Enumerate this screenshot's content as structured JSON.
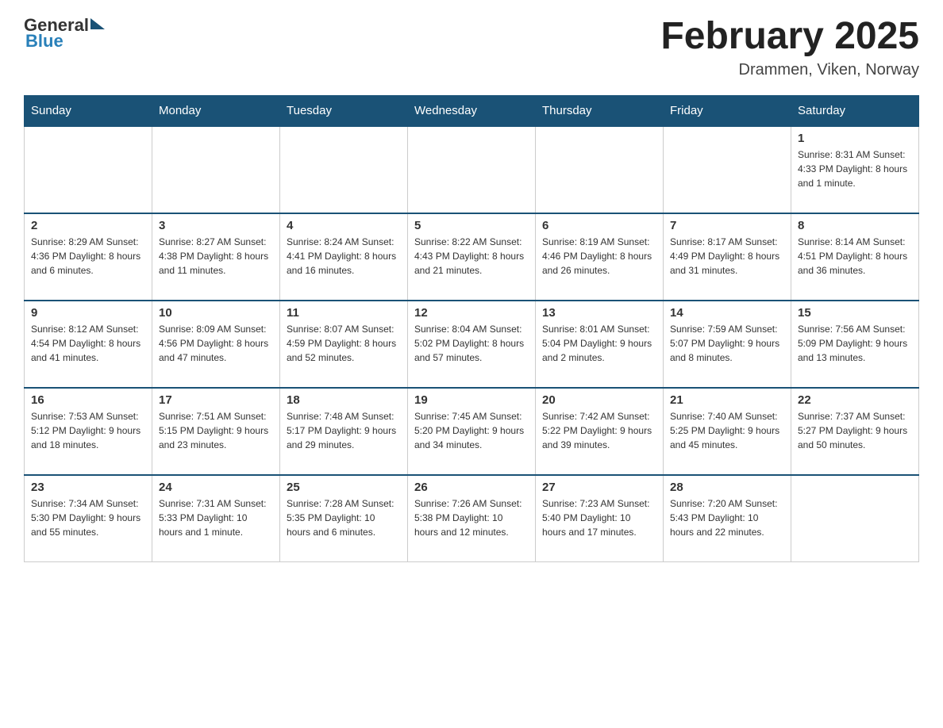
{
  "header": {
    "logo_general": "General",
    "logo_blue": "Blue",
    "month_title": "February 2025",
    "location": "Drammen, Viken, Norway"
  },
  "weekdays": [
    "Sunday",
    "Monday",
    "Tuesday",
    "Wednesday",
    "Thursday",
    "Friday",
    "Saturday"
  ],
  "weeks": [
    [
      {
        "day": "",
        "info": ""
      },
      {
        "day": "",
        "info": ""
      },
      {
        "day": "",
        "info": ""
      },
      {
        "day": "",
        "info": ""
      },
      {
        "day": "",
        "info": ""
      },
      {
        "day": "",
        "info": ""
      },
      {
        "day": "1",
        "info": "Sunrise: 8:31 AM\nSunset: 4:33 PM\nDaylight: 8 hours and 1 minute."
      }
    ],
    [
      {
        "day": "2",
        "info": "Sunrise: 8:29 AM\nSunset: 4:36 PM\nDaylight: 8 hours and 6 minutes."
      },
      {
        "day": "3",
        "info": "Sunrise: 8:27 AM\nSunset: 4:38 PM\nDaylight: 8 hours and 11 minutes."
      },
      {
        "day": "4",
        "info": "Sunrise: 8:24 AM\nSunset: 4:41 PM\nDaylight: 8 hours and 16 minutes."
      },
      {
        "day": "5",
        "info": "Sunrise: 8:22 AM\nSunset: 4:43 PM\nDaylight: 8 hours and 21 minutes."
      },
      {
        "day": "6",
        "info": "Sunrise: 8:19 AM\nSunset: 4:46 PM\nDaylight: 8 hours and 26 minutes."
      },
      {
        "day": "7",
        "info": "Sunrise: 8:17 AM\nSunset: 4:49 PM\nDaylight: 8 hours and 31 minutes."
      },
      {
        "day": "8",
        "info": "Sunrise: 8:14 AM\nSunset: 4:51 PM\nDaylight: 8 hours and 36 minutes."
      }
    ],
    [
      {
        "day": "9",
        "info": "Sunrise: 8:12 AM\nSunset: 4:54 PM\nDaylight: 8 hours and 41 minutes."
      },
      {
        "day": "10",
        "info": "Sunrise: 8:09 AM\nSunset: 4:56 PM\nDaylight: 8 hours and 47 minutes."
      },
      {
        "day": "11",
        "info": "Sunrise: 8:07 AM\nSunset: 4:59 PM\nDaylight: 8 hours and 52 minutes."
      },
      {
        "day": "12",
        "info": "Sunrise: 8:04 AM\nSunset: 5:02 PM\nDaylight: 8 hours and 57 minutes."
      },
      {
        "day": "13",
        "info": "Sunrise: 8:01 AM\nSunset: 5:04 PM\nDaylight: 9 hours and 2 minutes."
      },
      {
        "day": "14",
        "info": "Sunrise: 7:59 AM\nSunset: 5:07 PM\nDaylight: 9 hours and 8 minutes."
      },
      {
        "day": "15",
        "info": "Sunrise: 7:56 AM\nSunset: 5:09 PM\nDaylight: 9 hours and 13 minutes."
      }
    ],
    [
      {
        "day": "16",
        "info": "Sunrise: 7:53 AM\nSunset: 5:12 PM\nDaylight: 9 hours and 18 minutes."
      },
      {
        "day": "17",
        "info": "Sunrise: 7:51 AM\nSunset: 5:15 PM\nDaylight: 9 hours and 23 minutes."
      },
      {
        "day": "18",
        "info": "Sunrise: 7:48 AM\nSunset: 5:17 PM\nDaylight: 9 hours and 29 minutes."
      },
      {
        "day": "19",
        "info": "Sunrise: 7:45 AM\nSunset: 5:20 PM\nDaylight: 9 hours and 34 minutes."
      },
      {
        "day": "20",
        "info": "Sunrise: 7:42 AM\nSunset: 5:22 PM\nDaylight: 9 hours and 39 minutes."
      },
      {
        "day": "21",
        "info": "Sunrise: 7:40 AM\nSunset: 5:25 PM\nDaylight: 9 hours and 45 minutes."
      },
      {
        "day": "22",
        "info": "Sunrise: 7:37 AM\nSunset: 5:27 PM\nDaylight: 9 hours and 50 minutes."
      }
    ],
    [
      {
        "day": "23",
        "info": "Sunrise: 7:34 AM\nSunset: 5:30 PM\nDaylight: 9 hours and 55 minutes."
      },
      {
        "day": "24",
        "info": "Sunrise: 7:31 AM\nSunset: 5:33 PM\nDaylight: 10 hours and 1 minute."
      },
      {
        "day": "25",
        "info": "Sunrise: 7:28 AM\nSunset: 5:35 PM\nDaylight: 10 hours and 6 minutes."
      },
      {
        "day": "26",
        "info": "Sunrise: 7:26 AM\nSunset: 5:38 PM\nDaylight: 10 hours and 12 minutes."
      },
      {
        "day": "27",
        "info": "Sunrise: 7:23 AM\nSunset: 5:40 PM\nDaylight: 10 hours and 17 minutes."
      },
      {
        "day": "28",
        "info": "Sunrise: 7:20 AM\nSunset: 5:43 PM\nDaylight: 10 hours and 22 minutes."
      },
      {
        "day": "",
        "info": ""
      }
    ]
  ]
}
